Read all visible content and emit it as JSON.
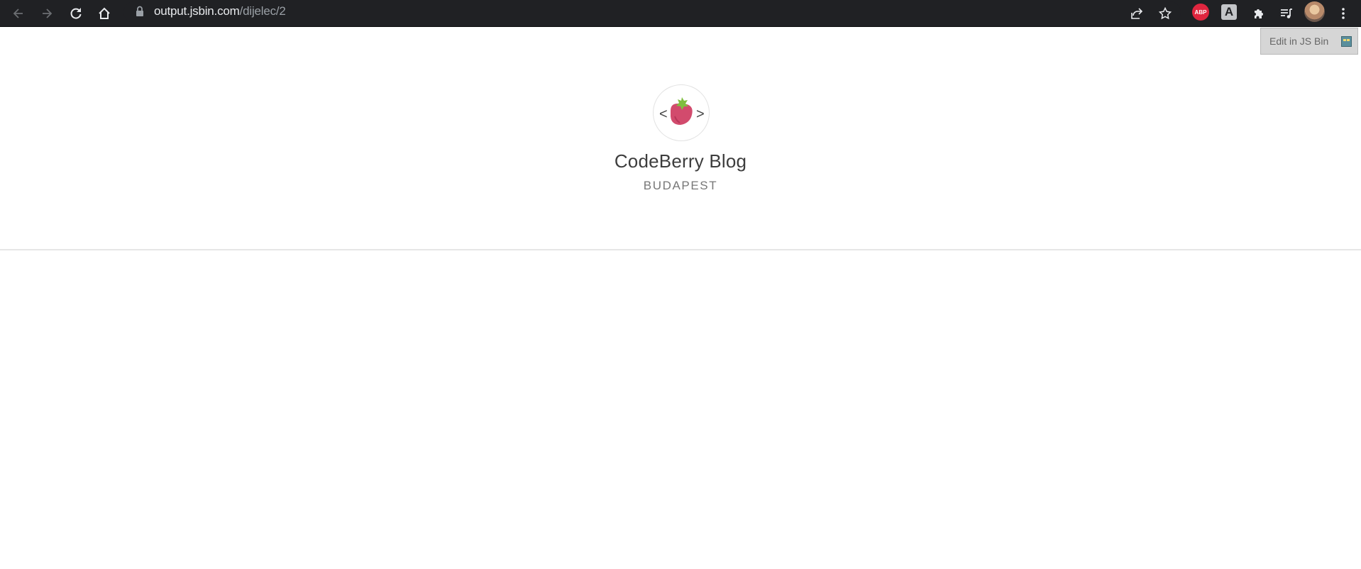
{
  "browser": {
    "url_domain": "output.jsbin.com",
    "url_path": "/dijelec/2",
    "extensions": {
      "abp_label": "ABP",
      "a_label": "A"
    }
  },
  "jsbin": {
    "edit_label": "Edit in JS Bin"
  },
  "blog": {
    "title": "CodeBerry Blog",
    "subtitle": "BUDAPEST",
    "logo_left": "<",
    "logo_right": ">"
  },
  "colors": {
    "toolbar": "#202124",
    "berry": "#d24b6d",
    "leaf": "#7fbf3f",
    "divider": "#e6e6e6"
  }
}
